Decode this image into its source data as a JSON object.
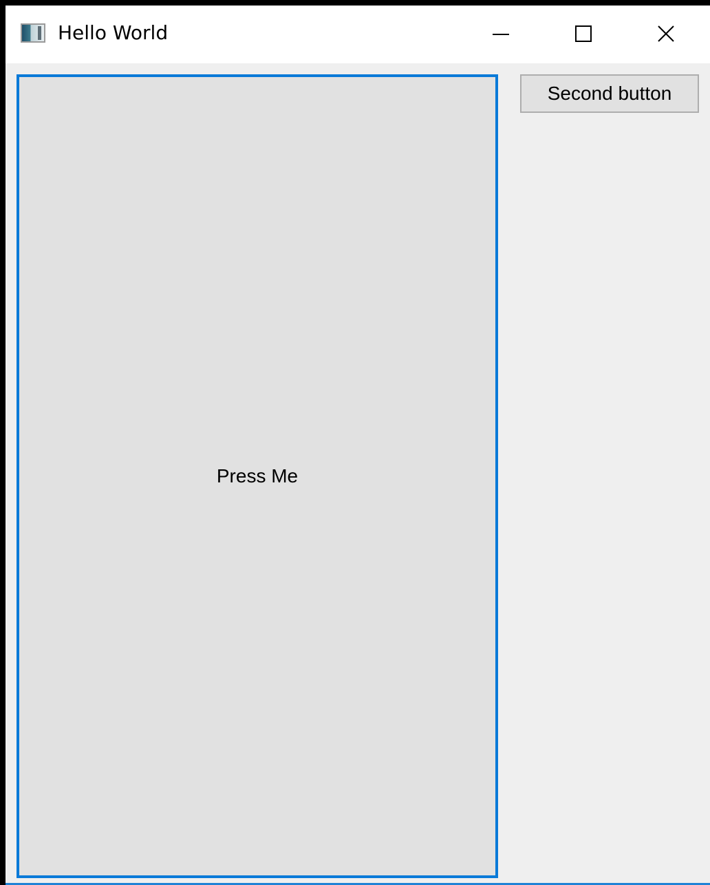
{
  "window": {
    "title": "Hello World",
    "app_icon": "window-app-icon",
    "controls": {
      "minimize_icon": "minimize-icon",
      "maximize_icon": "maximize-icon",
      "close_icon": "close-icon"
    }
  },
  "main": {
    "primary_button_label": "Press Me",
    "secondary_button_label": "Second button"
  },
  "colors": {
    "focus_border": "#0a7ad8",
    "button_face": "#e1e1e1",
    "window_background": "#efefef",
    "titlebar_background": "#ffffff"
  }
}
